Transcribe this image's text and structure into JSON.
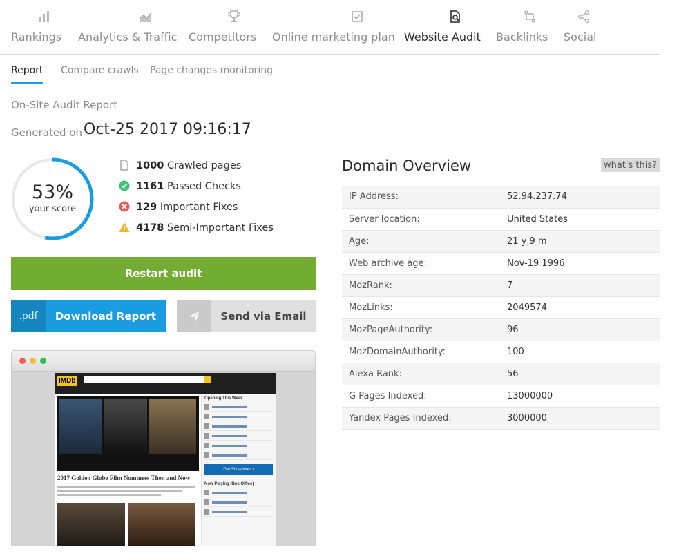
{
  "nav": {
    "items": [
      {
        "label": "Rankings",
        "icon": "bar-chart-icon"
      },
      {
        "label": "Analytics & Traffic",
        "icon": "area-chart-icon"
      },
      {
        "label": "Competitors",
        "icon": "trophy-icon"
      },
      {
        "label": "Online marketing plan",
        "icon": "checkbox-icon"
      },
      {
        "label": "Website Audit",
        "icon": "document-search-icon"
      },
      {
        "label": "Backlinks",
        "icon": "link-arrows-icon"
      },
      {
        "label": "Social",
        "icon": "share-icon"
      }
    ],
    "active": "Website Audit"
  },
  "subtabs": {
    "items": [
      "Report",
      "Compare crawls",
      "Page changes monitoring"
    ],
    "active": "Report"
  },
  "report": {
    "title": "On-Site Audit Report",
    "generated_label": "Generated on",
    "generated_date": "Oct-25 2017 09:16:17"
  },
  "score": {
    "percent_label": "53%",
    "value": 53,
    "subtitle": "your score",
    "color": "#1a9ce0"
  },
  "stats": [
    {
      "count": "1000",
      "label": "Crawled pages",
      "icon": "page-icon",
      "color": "#9a9a9a"
    },
    {
      "count": "1161",
      "label": "Passed Checks",
      "icon": "check-circle-icon",
      "color": "#3fc47a"
    },
    {
      "count": "129",
      "label": "Important Fixes",
      "icon": "error-circle-icon",
      "color": "#ec5b5b"
    },
    {
      "count": "4178",
      "label": "Semi-Important Fixes",
      "icon": "warning-triangle-icon",
      "color": "#f4b42a"
    }
  ],
  "buttons": {
    "restart": "Restart audit",
    "pdf_tag": ".pdf",
    "download": "Download Report",
    "email": "Send via Email"
  },
  "preview": {
    "logo": "IMDb",
    "caption": "2017 Golden Globe Film Nominees Then and Now",
    "sidebar_title": "Opening This Week",
    "sidebar_title2": "Now Playing (Box Office)",
    "showtimes": "Get Showtimes ›"
  },
  "domain": {
    "title": "Domain Overview",
    "help": "what's this?",
    "rows": [
      {
        "label": "IP Address:",
        "value": "52.94.237.74"
      },
      {
        "label": "Server location:",
        "value": "United States"
      },
      {
        "label": "Age:",
        "value": "21 y 9 m"
      },
      {
        "label": "Web archive age:",
        "value": "Nov-19 1996"
      },
      {
        "label": "MozRank:",
        "value": "7"
      },
      {
        "label": "MozLinks:",
        "value": "2049574"
      },
      {
        "label": "MozPageAuthority:",
        "value": "96"
      },
      {
        "label": "MozDomainAuthority:",
        "value": "100"
      },
      {
        "label": "Alexa Rank:",
        "value": "56"
      },
      {
        "label": "G Pages Indexed:",
        "value": "13000000"
      },
      {
        "label": "Yandex Pages Indexed:",
        "value": "3000000"
      }
    ]
  },
  "colors": {
    "accent": "#1a9ce0",
    "restart": "#73ac33"
  }
}
